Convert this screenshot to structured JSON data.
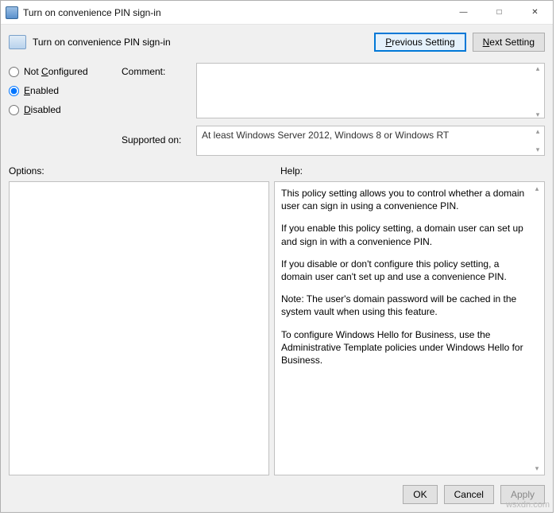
{
  "window": {
    "title": "Turn on convenience PIN sign-in"
  },
  "header": {
    "policy_title": "Turn on convenience PIN sign-in",
    "prev_button": "Previous Setting",
    "next_button": "Next Setting"
  },
  "radio": {
    "not_configured": "Not Configured",
    "enabled": "Enabled",
    "disabled": "Disabled",
    "selected": "enabled"
  },
  "labels": {
    "comment": "Comment:",
    "supported_on": "Supported on:",
    "options": "Options:",
    "help": "Help:"
  },
  "fields": {
    "comment_value": "",
    "supported_value": "At least Windows Server 2012, Windows 8 or Windows RT"
  },
  "help_text": {
    "p1": "This policy setting allows you to control whether a domain user can sign in using a convenience PIN.",
    "p2": "If you enable this policy setting, a domain user can set up and sign in with a convenience PIN.",
    "p3": "If you disable or don't configure this policy setting, a domain user can't set up and use a convenience PIN.",
    "p4": "Note: The user's domain password will be cached in the system vault when using this feature.",
    "p5": "To configure Windows Hello for Business, use the Administrative Template policies under Windows Hello for Business."
  },
  "footer": {
    "ok": "OK",
    "cancel": "Cancel",
    "apply": "Apply"
  },
  "watermark": "wsxdn.com"
}
